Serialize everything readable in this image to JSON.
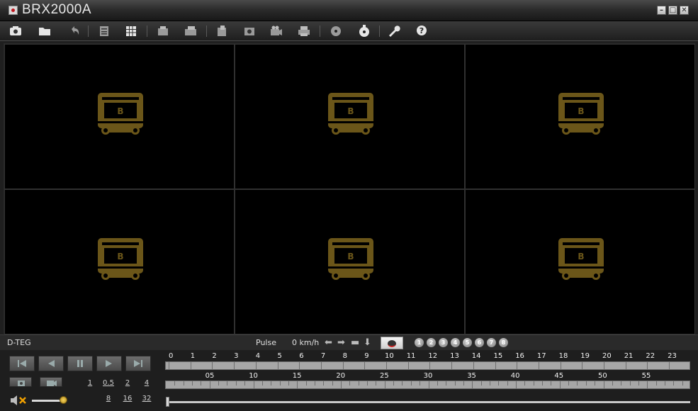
{
  "window": {
    "title": "BRX2000A",
    "minimize_label": "–",
    "maximize_label": "□",
    "close_label": "✕"
  },
  "toolbar": {
    "groups": [
      [
        "connect-icon",
        "open-folder-icon",
        "undo-icon"
      ],
      [
        "list-icon",
        "grid-icon"
      ],
      [
        "export-icon",
        "convert-icon"
      ],
      [
        "backup-icon",
        "snapshot-icon",
        "record-icon",
        "print-icon"
      ],
      [
        "disc-icon",
        "burn-icon"
      ],
      [
        "settings-wrench-icon",
        "help-icon"
      ]
    ]
  },
  "video": {
    "cells": 6,
    "placeholder_letter": "B",
    "placeholder_color": "#6b5619"
  },
  "status": {
    "device": "D-TEG",
    "pulse_label": "Pulse",
    "speed": "0 km/h",
    "channels": [
      "1",
      "2",
      "3",
      "4",
      "5",
      "6",
      "7",
      "8"
    ]
  },
  "playback": {
    "speeds_top": [
      "1",
      "0.5",
      "2",
      "4"
    ],
    "speeds_bottom": [
      "8",
      "16",
      "32"
    ]
  },
  "timeline": {
    "hours": [
      "0",
      "1",
      "2",
      "3",
      "4",
      "5",
      "6",
      "7",
      "8",
      "9",
      "10",
      "11",
      "12",
      "13",
      "14",
      "15",
      "16",
      "17",
      "18",
      "19",
      "20",
      "21",
      "22",
      "23"
    ],
    "minutes": [
      "05",
      "10",
      "15",
      "20",
      "25",
      "30",
      "35",
      "40",
      "45",
      "50",
      "55"
    ]
  },
  "colors": {
    "accent": "#c0161e",
    "bus_icon": "#6b5619",
    "timeline_fill": "#a7a7a7"
  }
}
